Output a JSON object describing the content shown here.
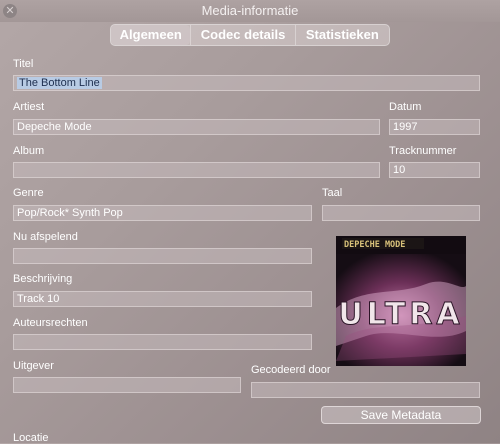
{
  "window": {
    "title": "Media-informatie"
  },
  "tabs": [
    {
      "label": "Algemeen",
      "active": true
    },
    {
      "label": "Codec details",
      "active": false
    },
    {
      "label": "Statistieken",
      "active": false
    }
  ],
  "fields": {
    "title": {
      "label": "Titel",
      "value": "The Bottom Line"
    },
    "artist": {
      "label": "Artiest",
      "value": "Depeche Mode"
    },
    "date": {
      "label": "Datum",
      "value": "1997"
    },
    "album": {
      "label": "Album",
      "value": ""
    },
    "track_number": {
      "label": "Tracknummer",
      "value": "10"
    },
    "genre": {
      "label": "Genre",
      "value": "Pop/Rock* Synth Pop"
    },
    "language": {
      "label": "Taal",
      "value": ""
    },
    "now_playing": {
      "label": "Nu afspelend",
      "value": ""
    },
    "description": {
      "label": "Beschrijving",
      "value": "Track 10"
    },
    "copyright": {
      "label": "Auteursrechten",
      "value": ""
    },
    "publisher": {
      "label": "Uitgever",
      "value": ""
    },
    "encoded_by": {
      "label": "Gecodeerd door",
      "value": ""
    },
    "location": {
      "label": "Locatie",
      "value": ""
    }
  },
  "artwork": {
    "band": "DEPECHE MODE",
    "album_title": "ULTRA"
  },
  "buttons": {
    "save_metadata": "Save Metadata"
  },
  "colors": {
    "selection": "#b8cbe4",
    "background": "#a89c9c"
  }
}
